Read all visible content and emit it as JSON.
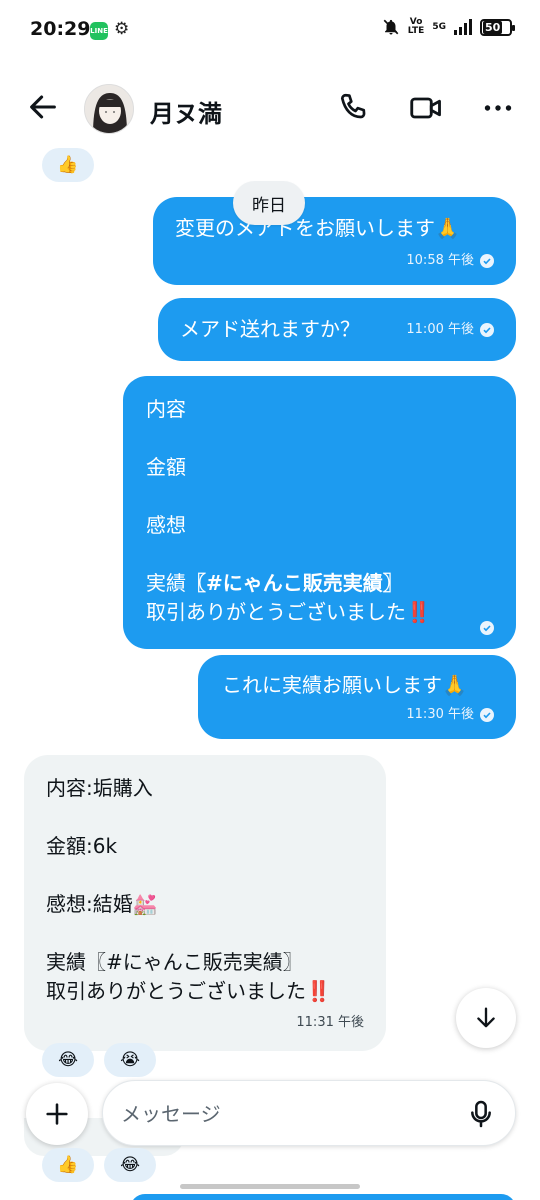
{
  "status_bar": {
    "time": "20:29",
    "line_app_label": "LINE",
    "volte": "Vo\nLTE",
    "network": "5G",
    "battery": "50"
  },
  "header": {
    "contact_name": "月ヌ満"
  },
  "date_separator": "昨日",
  "messages": [
    {
      "text": "変更のメアドをお願いします🙏",
      "time": "10:58 午後"
    },
    {
      "text": "メアド送れますか？",
      "time": "11:00 午後"
    },
    {
      "line1": "内容",
      "line2": "金額",
      "line3": "感想",
      "line4_prefix": "実績",
      "line4_tag": "〖#にゃんこ販売実績〗",
      "line5": "取引ありがとうございました‼️"
    },
    {
      "text": "これに実績お願いします🙏",
      "time": "11:30 午後"
    },
    {
      "text": "内容:垢購入\n\n金額:6k\n\n感想:結婚💒\n\n実績〖#にゃんこ販売実績〗\n取引ありがとうございました‼️",
      "time": "11:31 午後"
    }
  ],
  "reactions": {
    "top": "👍",
    "incoming_1": "😂",
    "incoming_2": "😭",
    "bottom_1": "👍",
    "bottom_2": "😂"
  },
  "composer": {
    "placeholder": "メッセージ"
  },
  "colors": {
    "outgoing_bubble": "#1d9bf0",
    "incoming_bubble": "#eff3f4",
    "reaction_bg": "#e3eff9"
  },
  "icons": [
    "back-arrow-icon",
    "phone-icon",
    "video-icon",
    "more-icon",
    "check-icon",
    "arrow-down-icon",
    "plus-icon",
    "microphone-icon",
    "gear-icon",
    "bell-off-icon",
    "signal-icon",
    "battery-icon"
  ]
}
